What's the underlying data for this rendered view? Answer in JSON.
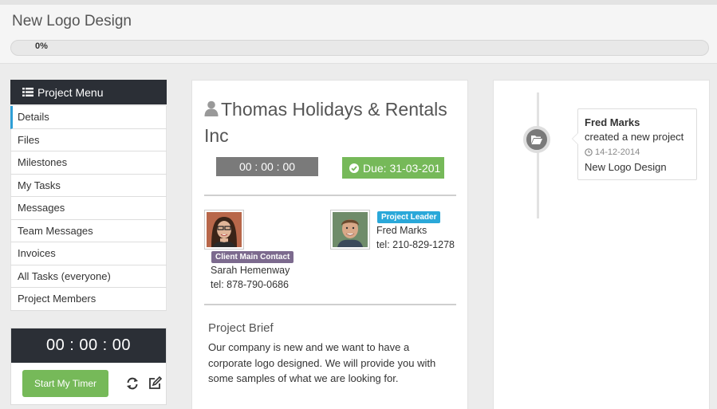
{
  "header": {
    "title": "New Logo Design",
    "progress_label": "0%",
    "progress_value": 0
  },
  "sidebar": {
    "menu_title": "Project Menu",
    "items": [
      {
        "label": "Details",
        "active": true
      },
      {
        "label": "Files"
      },
      {
        "label": "Milestones"
      },
      {
        "label": "My Tasks"
      },
      {
        "label": "Messages"
      },
      {
        "label": "Team Messages"
      },
      {
        "label": "Invoices"
      },
      {
        "label": "All Tasks (everyone)"
      },
      {
        "label": "Project Members"
      }
    ],
    "timer": {
      "display": "00 : 00 : 00",
      "start_label": "Start My Timer"
    }
  },
  "project": {
    "client_name": "Thomas Holidays & Rentals Inc",
    "timer": "00 : 00 : 00",
    "due": "Due: 31-03-201",
    "contact": {
      "badge": "Client Main Contact",
      "name": "Sarah Hemenway",
      "tel": "tel: 878-790-0686"
    },
    "leader": {
      "badge": "Project Leader",
      "name": "Fred Marks",
      "tel": "tel: 210-829-1278"
    },
    "brief_title": "Project Brief",
    "brief_text": "Our company is new and we want to have a corporate logo designed. We will provide you with some samples of what we are looking for."
  },
  "timeline": {
    "events": [
      {
        "name": "Fred Marks",
        "action": "created a new project",
        "date": "14-12-2014",
        "project": "New Logo Design"
      }
    ]
  },
  "colors": {
    "dark": "#2b2f36",
    "accent_blue": "#2e9fd6",
    "green": "#76b959",
    "badge_purple": "#7c6a8e",
    "badge_blue": "#2aa8d9"
  },
  "icons": [
    "list-icon",
    "refresh-icon",
    "edit-icon",
    "user-icon",
    "check-circle-icon",
    "folder-open-icon",
    "clock-icon"
  ]
}
